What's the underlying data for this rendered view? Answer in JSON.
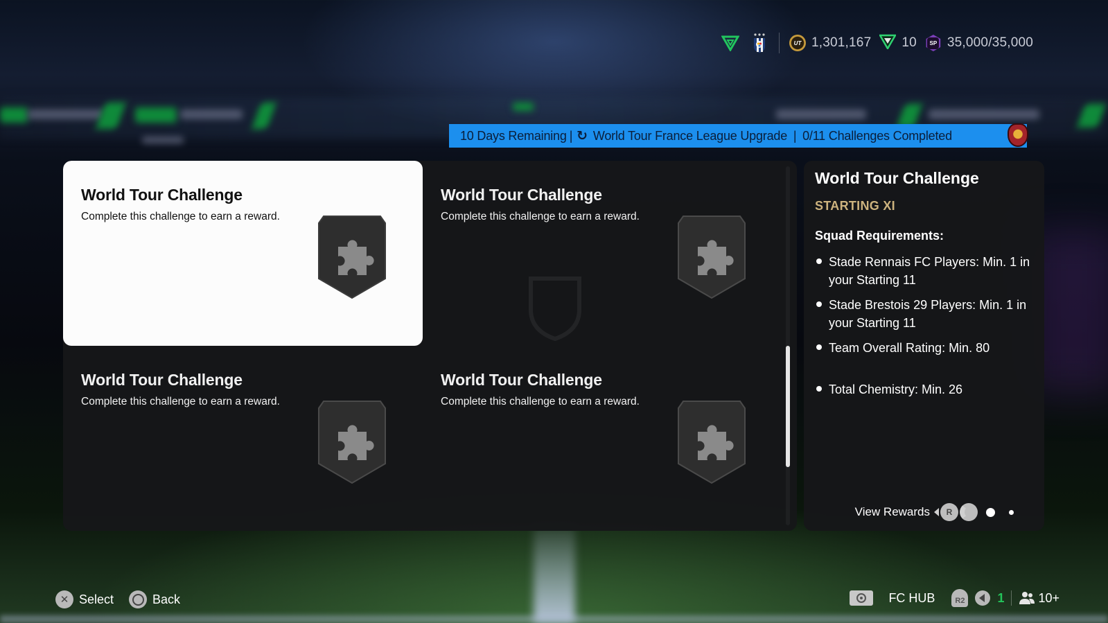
{
  "topbar": {
    "coins": "1,301,167",
    "fc_points": "10",
    "season_points": "35,000/35,000",
    "icons": [
      "club-badge-icon",
      "club-crest-icon",
      "coins-icon",
      "fc-points-icon",
      "sp-icon"
    ],
    "coin_label": "UT",
    "sp_label": "SP"
  },
  "banner": {
    "days_remaining": "10 Days Remaining",
    "title": "World Tour France League Upgrade",
    "progress": "0/11 Challenges Completed",
    "color": "#1c8fee"
  },
  "challenges": [
    {
      "title": "World Tour Challenge",
      "description": "Complete this challenge to earn a reward.",
      "selected": true
    },
    {
      "title": "World Tour Challenge",
      "description": "Complete this challenge to earn a reward.",
      "selected": false
    },
    {
      "title": "World Tour Challenge",
      "description": "Complete this challenge to earn a reward.",
      "selected": false
    },
    {
      "title": "World Tour Challenge",
      "description": "Complete this challenge to earn a reward.",
      "selected": false
    }
  ],
  "detail": {
    "title": "World Tour Challenge",
    "subtitle": "STARTING XI",
    "requirements_heading": "Squad Requirements:",
    "requirements": [
      "Stade Rennais FC Players: Min. 1 in your Starting 11",
      "Stade Brestois 29 Players: Min. 1 in your Starting 11",
      "Team Overall Rating: Min. 80",
      "Total Chemistry: Min. 26"
    ],
    "view_rewards": "View Rewards",
    "r_button": "R",
    "page_indicator": {
      "current": 1,
      "total": 2
    },
    "accent_color": "#cdb37e"
  },
  "footer": {
    "select": "Select",
    "back": "Back",
    "fc_hub": "FC HUB",
    "r2": "R2",
    "notification_count": "1",
    "friends_count": "10+"
  }
}
